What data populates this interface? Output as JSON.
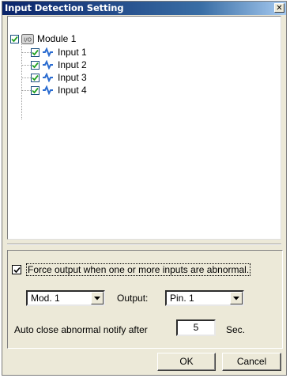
{
  "window": {
    "title": "Input Detection Setting",
    "close_glyph": "✕"
  },
  "tree": {
    "module": {
      "label": "Module 1",
      "checked": true,
      "icon": "io-module-icon"
    },
    "inputs": [
      {
        "label": "Input 1",
        "checked": true,
        "icon": "input-signal-icon"
      },
      {
        "label": "Input 2",
        "checked": true,
        "icon": "input-signal-icon"
      },
      {
        "label": "Input 3",
        "checked": true,
        "icon": "input-signal-icon"
      },
      {
        "label": "Input 4",
        "checked": true,
        "icon": "input-signal-icon"
      }
    ]
  },
  "options": {
    "force_output": {
      "label": "Force output when one or more inputs are abnormal.",
      "checked": true
    },
    "module_select": {
      "value": "Mod. 1"
    },
    "output_label": "Output:",
    "pin_select": {
      "value": "Pin. 1"
    },
    "auto_close_label": "Auto close abnormal notify after",
    "auto_close_value": "5",
    "sec_label": "Sec."
  },
  "buttons": {
    "ok": "OK",
    "cancel": "Cancel"
  },
  "colors": {
    "title_bar": "#0a246a",
    "dialog_bg": "#ece9d8",
    "check_mark": "#21a121",
    "icon_blue": "#2b6cd0"
  }
}
